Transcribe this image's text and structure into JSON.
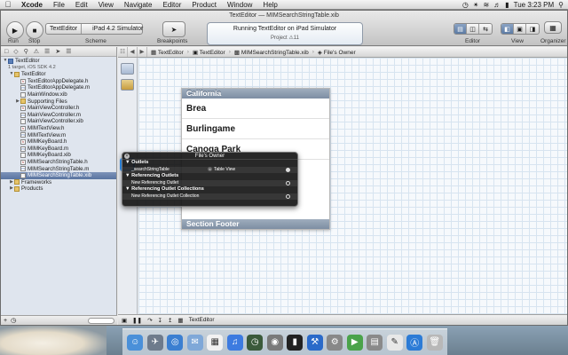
{
  "menubar": {
    "apple": "",
    "items": [
      "Xcode",
      "File",
      "Edit",
      "View",
      "Navigate",
      "Editor",
      "Product",
      "Window",
      "Help"
    ],
    "clock": "Tue 3:23 PM"
  },
  "window": {
    "title": "TextEditor — MIMSearchStringTable.xib"
  },
  "toolbar": {
    "run_label": "Run",
    "stop_label": "Stop",
    "scheme_target": "TextEditor",
    "scheme_destination": "iPad 4.2 Simulator",
    "scheme_label": "Scheme",
    "breakpoints_label": "Breakpoints",
    "activity_text": "Running TextEditor on iPad Simulator",
    "activity_sub": "Project",
    "activity_count": "11",
    "editor_label": "Editor",
    "view_label": "View",
    "organizer_label": "Organizer"
  },
  "navigator": {
    "items": [
      {
        "label": "TextEditor",
        "type": "proj",
        "indent": 0,
        "disclosure": "▼"
      },
      {
        "label": "1 target, iOS SDK 4.2",
        "type": "sub",
        "indent": 0,
        "disclosure": ""
      },
      {
        "label": "TextEditor",
        "type": "folder",
        "indent": 1,
        "disclosure": "▼"
      },
      {
        "label": "TextEditorAppDelegate.h",
        "type": "h",
        "indent": 2,
        "disclosure": ""
      },
      {
        "label": "TextEditorAppDelegate.m",
        "type": "m",
        "indent": 2,
        "disclosure": ""
      },
      {
        "label": "MainWindow.xib",
        "type": "xib",
        "indent": 2,
        "disclosure": ""
      },
      {
        "label": "Supporting Files",
        "type": "folder",
        "indent": 2,
        "disclosure": "▶"
      },
      {
        "label": "MainViewController.h",
        "type": "h",
        "indent": 2,
        "disclosure": ""
      },
      {
        "label": "MainViewController.m",
        "type": "m",
        "indent": 2,
        "disclosure": ""
      },
      {
        "label": "MainViewController.xib",
        "type": "xib",
        "indent": 2,
        "disclosure": ""
      },
      {
        "label": "MIMTextView.h",
        "type": "h",
        "indent": 2,
        "disclosure": ""
      },
      {
        "label": "MIMTextView.m",
        "type": "m",
        "indent": 2,
        "disclosure": ""
      },
      {
        "label": "MIMKeyBoard.h",
        "type": "h",
        "indent": 2,
        "disclosure": ""
      },
      {
        "label": "MIMKeyBoard.m",
        "type": "m",
        "indent": 2,
        "disclosure": ""
      },
      {
        "label": "MIMKeyBoard.xib",
        "type": "xib",
        "indent": 2,
        "disclosure": ""
      },
      {
        "label": "MIMSearchStringTable.h",
        "type": "h",
        "indent": 2,
        "disclosure": ""
      },
      {
        "label": "MIMSearchStringTable.m",
        "type": "m",
        "indent": 2,
        "disclosure": ""
      },
      {
        "label": "MIMSearchStringTable.xib",
        "type": "xib",
        "indent": 2,
        "disclosure": "",
        "selected": true
      },
      {
        "label": "Frameworks",
        "type": "folder",
        "indent": 1,
        "disclosure": "▶"
      },
      {
        "label": "Products",
        "type": "folder",
        "indent": 1,
        "disclosure": "▶"
      }
    ]
  },
  "jumpbar": {
    "crumbs": [
      "TextEditor",
      "TextEditor",
      "MIMSearchStringTable.xib",
      "File's Owner"
    ]
  },
  "tableview": {
    "header": "California",
    "cells": [
      "Brea",
      "Burlingame",
      "Canoga Park"
    ],
    "footer": "Section Footer"
  },
  "hud": {
    "title": "File's Owner",
    "sections": [
      {
        "title": "Outlets",
        "rows": [
          {
            "name": "_searchStringTable",
            "target": "Table View",
            "connected": true
          }
        ]
      },
      {
        "title": "Referencing Outlets",
        "rows": [
          {
            "name": "New Referencing Outlet",
            "target": "",
            "connected": false
          }
        ]
      },
      {
        "title": "Referencing Outlet Collections",
        "rows": [
          {
            "name": "New Referencing Outlet Collection",
            "target": "",
            "connected": false
          }
        ]
      }
    ]
  },
  "editor_bottom": {
    "label": "TextEditor"
  },
  "colors": {
    "selection": "#5a74a0",
    "section_header": "#8a9ab0",
    "hud_bg": "#161616"
  },
  "dock": {
    "icons": [
      "finder-icon",
      "launchpad-icon",
      "safari-icon",
      "mail-icon",
      "calendar-icon",
      "itunes-icon",
      "time-machine-icon",
      "photo-booth-icon",
      "terminal-icon",
      "xcode-icon",
      "system-preferences-icon",
      "facetime-icon",
      "preview-icon",
      "textedit-icon",
      "app-store-icon",
      "trash-icon"
    ]
  }
}
